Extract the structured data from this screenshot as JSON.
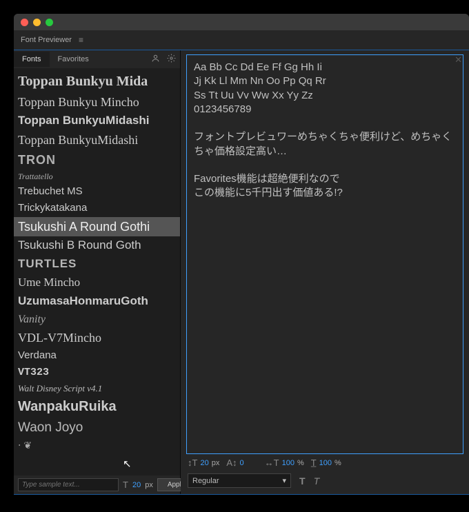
{
  "header": {
    "title": "Font Previewer"
  },
  "tabs": {
    "fonts": "Fonts",
    "favorites": "Favorites"
  },
  "fonts": {
    "items": [
      {
        "label": "Toppan Bunkyu Mida",
        "style": "font-family:'Times New Roman',serif;font-size:20px;font-weight:600;color:#ccc"
      },
      {
        "label": "Toppan Bunkyu Mincho",
        "style": "font-family:'Times New Roman',serif;font-size:18px;color:#ccc"
      },
      {
        "label": "Toppan BunkyuMidashi",
        "style": "font-family:Arial,sans-serif;font-size:17px;font-weight:800;color:#ccc"
      },
      {
        "label": "Toppan BunkyuMidashi",
        "style": "font-family:'Times New Roman',serif;font-size:18px;color:#ccc"
      },
      {
        "label": "TRON",
        "style": "font-family:Arial,sans-serif;font-size:18px;font-weight:700;letter-spacing:1px;color:#b0b0b0"
      },
      {
        "label": "Trattatello",
        "style": "font-family:cursive;font-size:12px;font-style:italic;color:#b0b0b0"
      },
      {
        "label": "Trebuchet MS",
        "style": "font-family:'Trebuchet MS',sans-serif;font-size:15px;color:#ccc"
      },
      {
        "label": "Trickykatakana",
        "style": "font-family:Arial,sans-serif;font-size:15px;color:#ccc"
      },
      {
        "label": "Tsukushi A Round Gothi",
        "style": "font-family:Arial,sans-serif;font-size:18px;color:#eee",
        "selected": true
      },
      {
        "label": "Tsukushi B Round Goth",
        "style": "font-family:Arial,sans-serif;font-size:17px;color:#ccc"
      },
      {
        "label": "TURTLES",
        "style": "font-family:Impact,sans-serif;font-size:17px;font-weight:800;letter-spacing:1px;color:#b8b8b8"
      },
      {
        "label": "Ume Mincho",
        "style": "font-family:serif;font-size:17px;color:#ccc"
      },
      {
        "label": "UzumasaHonmaruGoth",
        "style": "font-family:Arial,sans-serif;font-size:17px;font-weight:600;color:#ccc"
      },
      {
        "label": "Vanity",
        "style": "font-family:serif;font-size:16px;font-style:italic;color:#aaa"
      },
      {
        "label": "VDL-V7Mincho",
        "style": "font-family:serif;font-size:18px;color:#ccc"
      },
      {
        "label": "Verdana",
        "style": "font-family:Verdana,sans-serif;font-size:15px;color:#ccc"
      },
      {
        "label": "VT323",
        "style": "font-family:monospace;font-size:15px;font-weight:700;color:#ccc"
      },
      {
        "label": "Walt Disney Script v4.1",
        "style": "font-family:cursive;font-size:13px;font-style:italic;color:#bbb"
      },
      {
        "label": "WanpakuRuika",
        "style": "font-family:Arial,sans-serif;font-size:20px;font-weight:800;color:#ccc"
      },
      {
        "label": "Waon Joyo",
        "style": "font-family:Arial,sans-serif;font-size:19px;font-weight:300;color:#bbb"
      },
      {
        "label": "‧ ❦",
        "style": "font-size:14px;color:#aaa"
      }
    ]
  },
  "sample": {
    "placeholder": "Type sample text...",
    "size_value": "20",
    "size_unit": "px",
    "apply": "Apply"
  },
  "preview": {
    "text": "Aa Bb Cc Dd Ee Ff Gg Hh Ii\nJj Kk Ll Mm Nn Oo Pp Qq Rr\nSs Tt Uu Vv Ww Xx Yy Zz\n0123456789\n\nフォントプレビュワーめちゃくちゃ便利けど、めちゃくちゃ価格設定高い…\n\nFavorites機能は超絶便利なので\nこの機能に5千円出す価値ある!?"
  },
  "controls": {
    "font_size": "20",
    "font_size_unit": "px",
    "leading": "0",
    "hscale": "100",
    "hscale_unit": "%",
    "vscale": "100",
    "vscale_unit": "%",
    "weight": "Regular"
  }
}
